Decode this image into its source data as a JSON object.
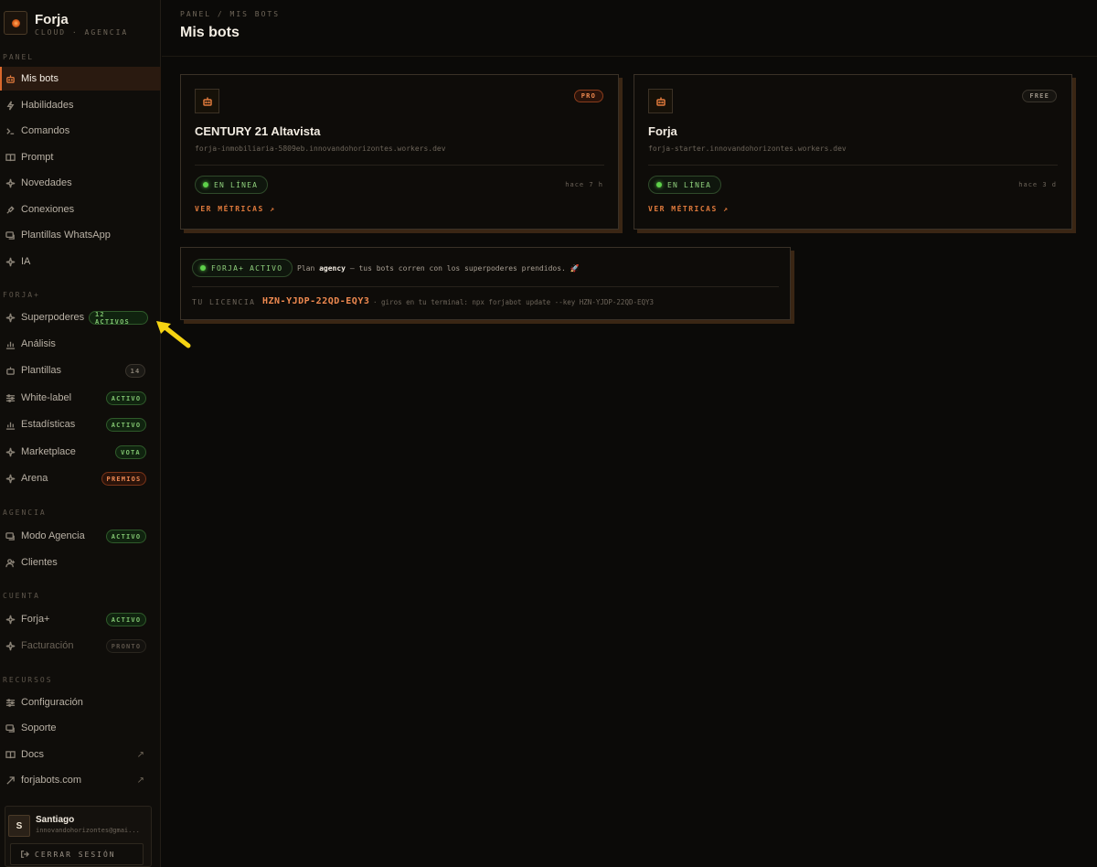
{
  "brand": {
    "name": "Forja",
    "subtitle": "CLOUD · AGENCIA"
  },
  "sidebar": {
    "sections": {
      "panel": "PANEL",
      "forja_plus": "FORJA+",
      "agencia": "AGENCIA",
      "cuenta": "CUENTA",
      "recursos": "RECURSOS"
    },
    "panel_items": [
      {
        "label": "Mis bots",
        "icon": "robot-icon",
        "active": true
      },
      {
        "label": "Habilidades",
        "icon": "lightning-icon"
      },
      {
        "label": "Comandos",
        "icon": "terminal-icon"
      },
      {
        "label": "Prompt",
        "icon": "book-icon"
      },
      {
        "label": "Novedades",
        "icon": "sparkle-icon"
      },
      {
        "label": "Conexiones",
        "icon": "plug-icon"
      },
      {
        "label": "Plantillas WhatsApp",
        "icon": "chat-icon"
      },
      {
        "label": "IA",
        "icon": "sparkle-icon"
      }
    ],
    "forja_items": [
      {
        "label": "Superpoderes",
        "icon": "sparkle-icon",
        "badge": "12 ACTIVOS"
      },
      {
        "label": "Análisis",
        "icon": "bar-chart-icon"
      },
      {
        "label": "Plantillas",
        "icon": "template-icon",
        "badge": "14"
      },
      {
        "label": "White-label",
        "icon": "sliders-icon",
        "badge": "ACTIVO"
      },
      {
        "label": "Estadísticas",
        "icon": "bar-chart-icon",
        "badge": "ACTIVO"
      },
      {
        "label": "Marketplace",
        "icon": "sparkle-icon",
        "badge": "VOTA"
      },
      {
        "label": "Arena",
        "icon": "sparkle-icon",
        "badge": "PREMIOS"
      }
    ],
    "agencia_items": [
      {
        "label": "Modo Agencia",
        "icon": "chat-icon",
        "badge": "ACTIVO"
      },
      {
        "label": "Clientes",
        "icon": "users-icon"
      }
    ],
    "cuenta_items": [
      {
        "label": "Forja+",
        "icon": "sparkle-icon",
        "badge": "ACTIVO"
      },
      {
        "label": "Facturación",
        "icon": "sparkle-icon",
        "badge": "PRONTO"
      }
    ],
    "recursos_items": [
      {
        "label": "Configuración",
        "icon": "sliders-icon"
      },
      {
        "label": "Soporte",
        "icon": "chat-icon"
      },
      {
        "label": "Docs",
        "icon": "book-icon",
        "external": "↗"
      },
      {
        "label": "forjabots.com",
        "icon": "link-arrow-icon",
        "external": "↗"
      }
    ]
  },
  "user": {
    "initial": "S",
    "name": "Santiago",
    "email": "innovandohorizontes@gmai...",
    "logout_label": "CERRAR SESIÓN"
  },
  "header": {
    "breadcrumb": "PANEL / MIS BOTS",
    "title": "Mis bots"
  },
  "bots": [
    {
      "plan": "PRO",
      "name": "CENTURY 21 Altavista",
      "url": "forja-inmobiliaria-5809eb.innovandohorizontes.workers.dev",
      "status": "EN LÍNEA",
      "updated": "hace 7 h",
      "metrics_label": "VER MÉTRICAS ↗"
    },
    {
      "plan": "FREE",
      "name": "Forja",
      "url": "forja-starter.innovandohorizontes.workers.dev",
      "status": "EN LÍNEA",
      "updated": "hace 3 d",
      "metrics_label": "VER MÉTRICAS ↗"
    }
  ],
  "forja_plus": {
    "status": "FORJA+ ACTIVO",
    "plan_prefix": "Plan",
    "plan_name": "agency",
    "plan_suffix": "— tus bots corren con los superpoderes prendidos. 🚀",
    "license_label": "TU LICENCIA",
    "license_key": "HZN-YJDP-22QD-EQY3",
    "license_hint": "· giros en tu terminal: npx forjabot update --key HZN-YJDP-22QD-EQY3"
  },
  "colors": {
    "accent": "#e07a3c",
    "active_green": "#5ed14a",
    "annotation_arrow": "#f5d312"
  }
}
